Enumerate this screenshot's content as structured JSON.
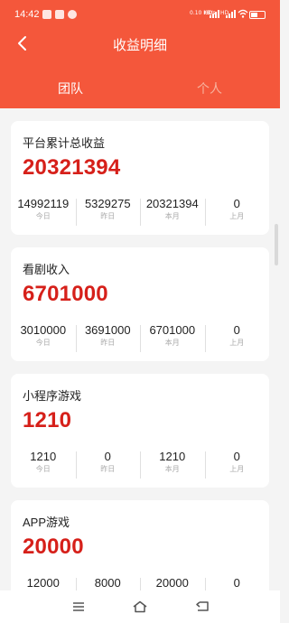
{
  "status_bar": {
    "time": "14:42",
    "network_labels": [
      "0.10 KB/s",
      "HD",
      "HD"
    ]
  },
  "header": {
    "title": "收益明细",
    "tabs": [
      {
        "label": "团队",
        "active": true
      },
      {
        "label": "个人",
        "active": false
      }
    ]
  },
  "cards": [
    {
      "title": "平台累计总收益",
      "total": "20321394",
      "stats": [
        {
          "value": "14992119",
          "label": "今日"
        },
        {
          "value": "5329275",
          "label": "昨日"
        },
        {
          "value": "20321394",
          "label": "本月"
        },
        {
          "value": "0",
          "label": "上月"
        }
      ]
    },
    {
      "title": "看剧收入",
      "total": "6701000",
      "stats": [
        {
          "value": "3010000",
          "label": "今日"
        },
        {
          "value": "3691000",
          "label": "昨日"
        },
        {
          "value": "6701000",
          "label": "本月"
        },
        {
          "value": "0",
          "label": "上月"
        }
      ]
    },
    {
      "title": "小程序游戏",
      "total": "1210",
      "stats": [
        {
          "value": "1210",
          "label": "今日"
        },
        {
          "value": "0",
          "label": "昨日"
        },
        {
          "value": "1210",
          "label": "本月"
        },
        {
          "value": "0",
          "label": "上月"
        }
      ]
    },
    {
      "title": "APP游戏",
      "total": "20000",
      "stats": [
        {
          "value": "12000",
          "label": ""
        },
        {
          "value": "8000",
          "label": ""
        },
        {
          "value": "20000",
          "label": ""
        },
        {
          "value": "0",
          "label": ""
        }
      ]
    }
  ],
  "bottom_nav": [
    "menu-icon",
    "home-icon",
    "back-icon"
  ],
  "colors": {
    "accent": "#f4573b",
    "amount": "#d6201a",
    "background": "#f4f4f4"
  }
}
